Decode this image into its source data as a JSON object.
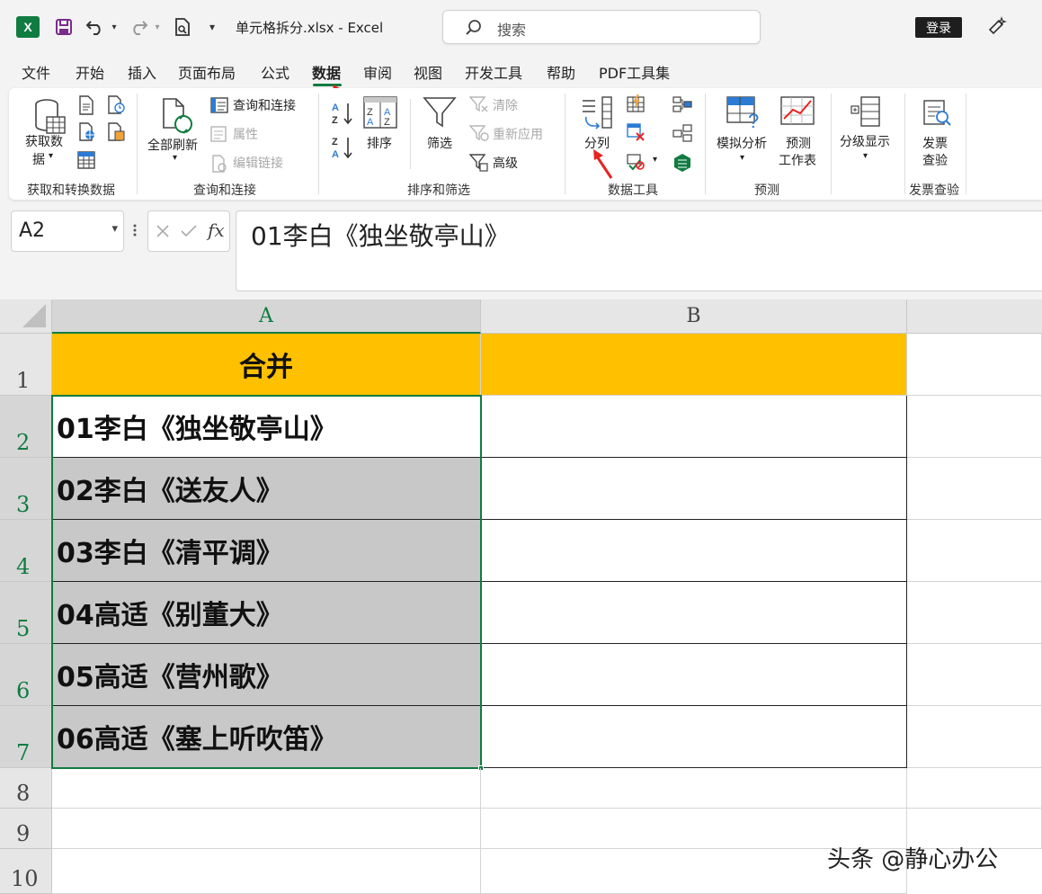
{
  "titlebar": {
    "filename": "单元格拆分.xlsx  -  Excel",
    "search_placeholder": "搜索",
    "login_label": "登录",
    "excel_logo": "X"
  },
  "menu": {
    "items": [
      "文件",
      "开始",
      "插入",
      "页面布局",
      "公式",
      "数据",
      "审阅",
      "视图",
      "开发工具",
      "帮助",
      "PDF工具集"
    ],
    "active": "数据"
  },
  "ribbon": {
    "get_data": "获取数",
    "get_data2": "据",
    "group_get": "获取和转换数据",
    "refresh_all": "全部刷新",
    "query_conn": "查询和连接",
    "properties": "属性",
    "edit_links": "编辑链接",
    "group_query": "查询和连接",
    "sort": "排序",
    "filter": "筛选",
    "clear": "清除",
    "reapply": "重新应用",
    "advanced": "高级",
    "group_sort": "排序和筛选",
    "text_to_columns": "分列",
    "group_data_tools": "数据工具",
    "whatif": "模拟分析",
    "forecast_sheet_1": "预测",
    "forecast_sheet_2": "工作表",
    "group_forecast": "预测",
    "outline": "分级显示",
    "invoice_1": "发票",
    "invoice_2": "查验",
    "group_invoice": "发票查验"
  },
  "formula_bar": {
    "name_box": "A2",
    "formula": "01李白《独坐敬亭山》",
    "fx": "fx"
  },
  "sheet": {
    "columns": [
      "A",
      "B"
    ],
    "rows": [
      "1",
      "2",
      "3",
      "4",
      "5",
      "6",
      "7",
      "8",
      "9",
      "10"
    ],
    "header_cell": "合并",
    "cells": [
      "01李白《独坐敬亭山》",
      "02李白《送友人》",
      "03李白《清平调》",
      "04高适《别董大》",
      "05高适《营州歌》",
      "06高适《塞上听吹笛》"
    ]
  },
  "watermark": "头条 @静心办公",
  "colors": {
    "accent": "#107c41",
    "header_fill": "#ffc000",
    "selection_fill": "#c8c8c8",
    "arrow": "#e8231f"
  }
}
